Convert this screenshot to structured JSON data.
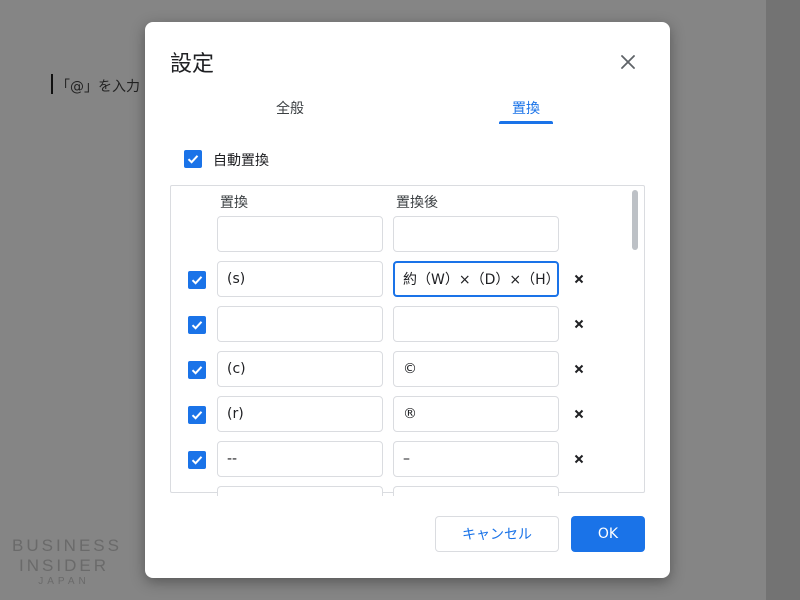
{
  "background": {
    "doc_hint": "「@」を入力",
    "watermark": {
      "line1": "BUSINESS",
      "line2": "INSIDER",
      "line3": "JAPAN"
    }
  },
  "dialog": {
    "title": "設定",
    "close_icon": "close-icon",
    "tabs": [
      {
        "label": "全般",
        "active": false
      },
      {
        "label": "置換",
        "active": true
      }
    ],
    "auto_replace": {
      "label": "自動置換",
      "checked": true
    },
    "table": {
      "headers": {
        "from": "置換",
        "to": "置換後"
      },
      "rows": [
        {
          "checked": null,
          "from": "",
          "to": ""
        },
        {
          "checked": true,
          "from": "(s)",
          "to": "約（W）×（D）×（H）"
        },
        {
          "checked": true,
          "from": "",
          "to": ""
        },
        {
          "checked": true,
          "from": "(c)",
          "to": "©"
        },
        {
          "checked": true,
          "from": "(r)",
          "to": "®"
        },
        {
          "checked": true,
          "from": "--",
          "to": "–"
        },
        {
          "checked": null,
          "from": "",
          "to": ""
        }
      ],
      "delete_icon": "×"
    },
    "buttons": {
      "cancel": "キャンセル",
      "ok": "OK"
    },
    "accent_color": "#1a73e8"
  }
}
